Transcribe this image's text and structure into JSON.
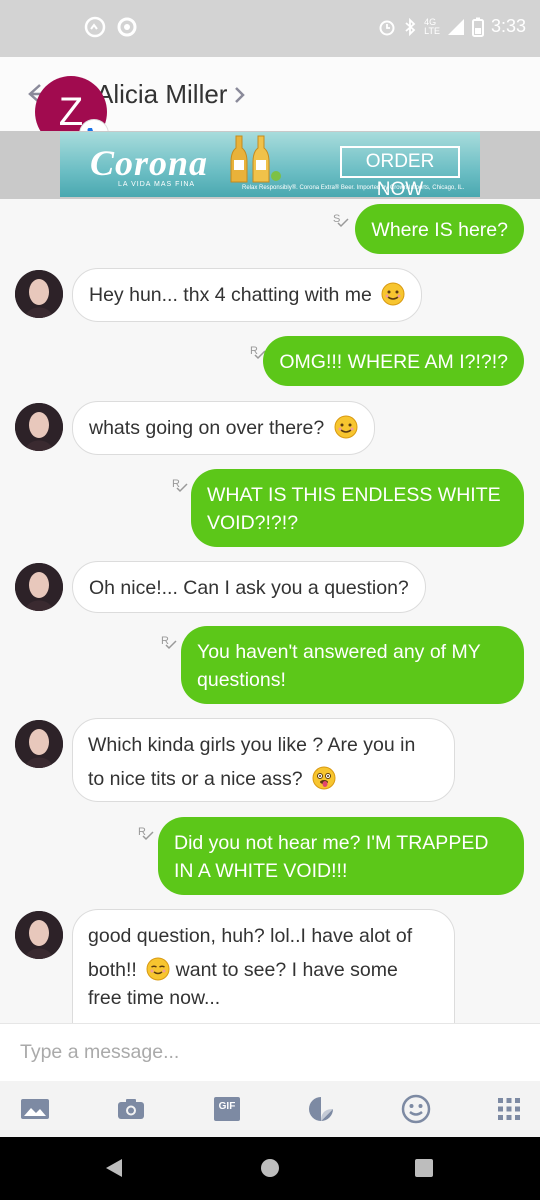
{
  "status_bar": {
    "time": "3:33",
    "network": "4G\nLTE"
  },
  "header": {
    "contact_name": "Alicia Miller",
    "avatar_initial": "Z"
  },
  "ad": {
    "brand": "Corona",
    "tagline": "LA VIDA MAS FINA",
    "cta": "ORDER NOW",
    "fine_print": "Relax Responsibly®. Corona Extra® Beer. Imported by Crown Imports, Chicago, IL."
  },
  "messages": [
    {
      "direction": "out",
      "receipt": "S",
      "text": "Where IS here?"
    },
    {
      "direction": "in",
      "text": "Hey hun... thx 4 chatting with me"
    },
    {
      "direction": "out",
      "receipt": "R",
      "text": "OMG!!! WHERE AM I?!?!?"
    },
    {
      "direction": "in",
      "text": "whats going on over there?"
    },
    {
      "direction": "out",
      "receipt": "R",
      "line1": "WHAT IS THIS ENDLESS WHITE",
      "line2": "VOID?!?!?"
    },
    {
      "direction": "in",
      "text": "Oh nice!... Can I ask you a question?"
    },
    {
      "direction": "out",
      "receipt": "R",
      "line1": "You haven't answered any of MY",
      "line2": "questions!"
    },
    {
      "direction": "in",
      "line1": "Which kinda girls you like ? Are you in",
      "line2": "to nice tits or a nice ass?"
    },
    {
      "direction": "out",
      "receipt": "R",
      "line1": "Did you not hear me? I'M TRAPPED",
      "line2": "IN A WHITE VOID!!!"
    },
    {
      "direction": "in",
      "line1": "good question, huh? lol..I have alot of",
      "line2a": "both!!",
      "line2b": "want to see? I have some",
      "line3": "free time now..."
    }
  ],
  "composer": {
    "placeholder": "Type a message...",
    "gif_label": "GIF",
    "tools": [
      "image-icon",
      "camera-icon",
      "gif-icon",
      "sticker-icon",
      "emoji-icon",
      "more-grid-icon"
    ]
  },
  "colors": {
    "outgoing_bubble": "#5cc719",
    "avatar_bg": "#a10b4f",
    "accent_blue": "#1a73e8"
  }
}
